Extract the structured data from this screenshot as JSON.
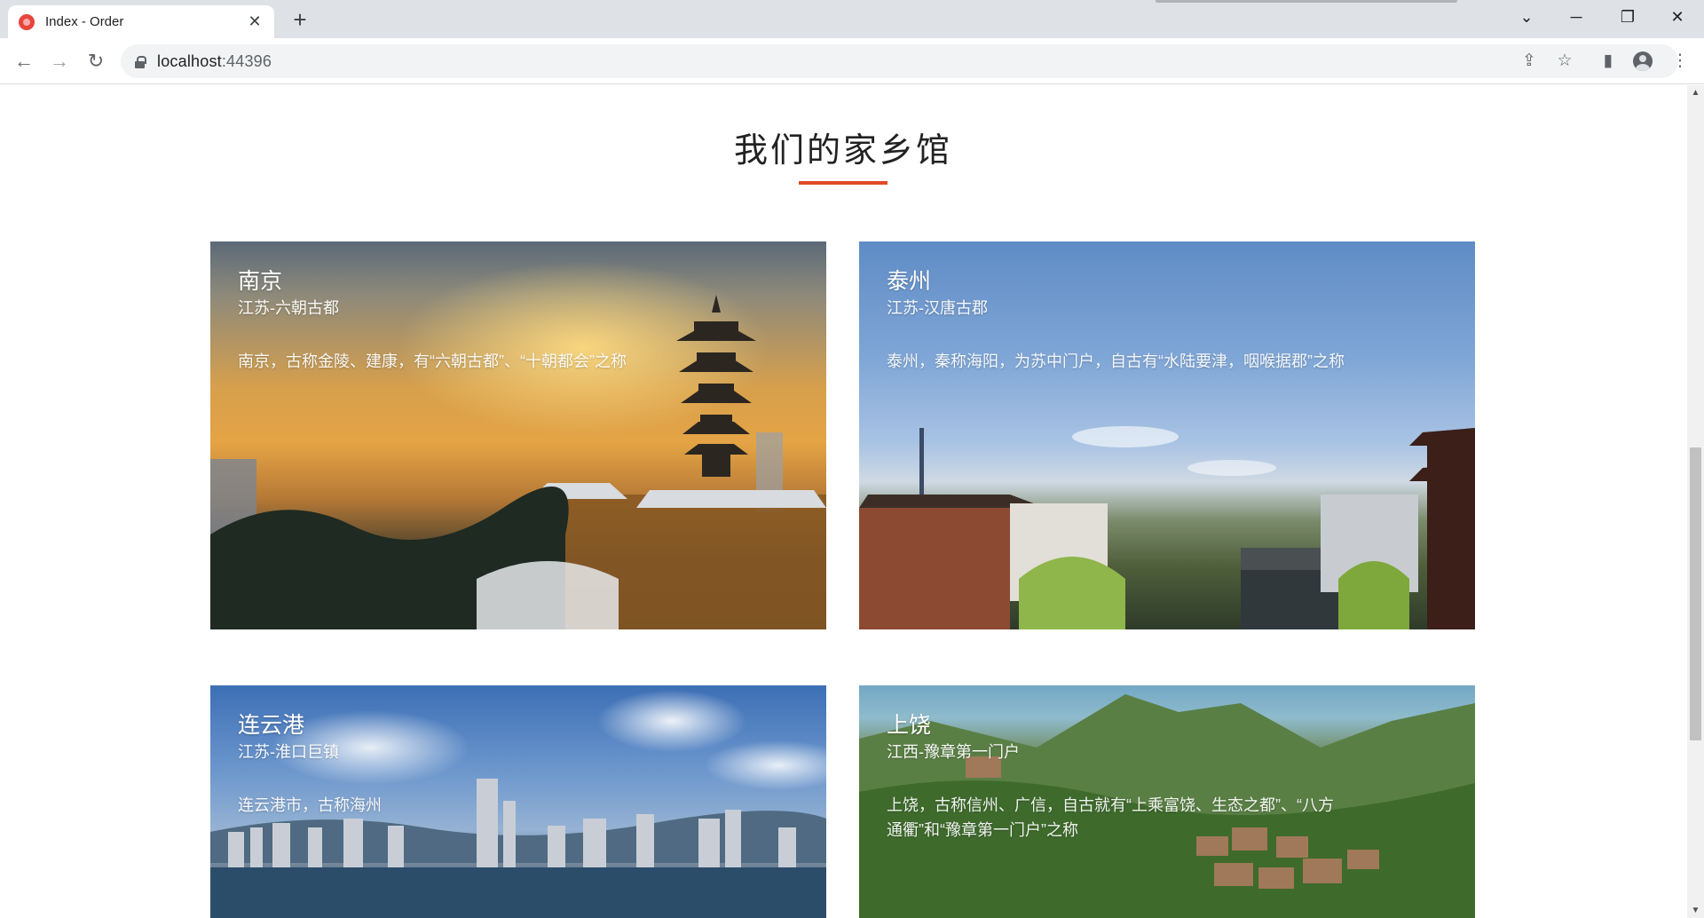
{
  "browser": {
    "tab_title": "Index - Order",
    "url_host": "localhost",
    "url_port": ":44396",
    "icons": [
      "favicon",
      "close-icon",
      "new-tab-icon",
      "back-icon",
      "forward-icon",
      "reload-icon",
      "lock-icon",
      "share-icon",
      "star-icon",
      "side-panel-icon",
      "profile-icon",
      "menu-icon"
    ],
    "glyphs": {
      "close": "✕",
      "new_tab": "+",
      "tab_search": "⌄",
      "minimize": "─",
      "restore": "❐",
      "window_close": "✕",
      "back": "←",
      "forward": "→",
      "reload": "↻",
      "share": "⇪",
      "star": "☆",
      "side_panel": "▮",
      "menu": "⋮",
      "scroll_up": "▲",
      "scroll_down": "▼"
    }
  },
  "page": {
    "section_title": "我们的家乡馆",
    "accent_color": "#e04a25",
    "cards": [
      {
        "city": "南京",
        "region": "江苏-六朝古都",
        "description": "南京，古称金陵、建康，有“六朝古都”、“十朝都会”之称"
      },
      {
        "city": "泰州",
        "region": "江苏-汉唐古郡",
        "description": "泰州，秦称海阳，为苏中门户，自古有“水陆要津，咽喉据郡”之称"
      },
      {
        "city": "连云港",
        "region": "江苏-淮口巨镇",
        "description": "连云港市，古称海州"
      },
      {
        "city": "上饶",
        "region": "江西-豫章第一门户",
        "description": "上饶，古称信州、广信，自古就有“上乘富饶、生态之都”、“八方通衢”和“豫章第一门户”之称"
      }
    ]
  }
}
